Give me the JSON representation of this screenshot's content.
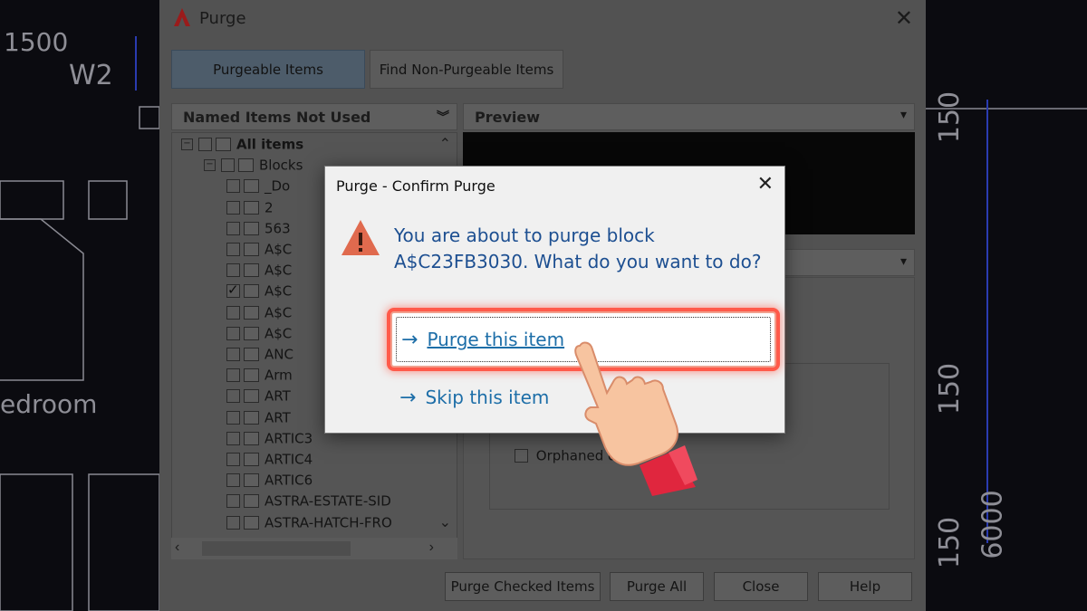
{
  "background_cad": {
    "labels": [
      "1500",
      "W2",
      "edroom"
    ],
    "vertical_labels": [
      "150",
      "150",
      "150",
      "6000"
    ]
  },
  "purge_dialog": {
    "title": "Purge",
    "tabs": [
      "Purgeable Items",
      "Find Non-Purgeable Items"
    ],
    "tree_header": "Named Items Not Used",
    "preview_header": "Preview",
    "tree_items": [
      {
        "label": "All items",
        "level": 0,
        "checked": false
      },
      {
        "label": "Blocks",
        "level": 1,
        "checked": false
      },
      {
        "label": "_Do",
        "level": 2,
        "checked": false
      },
      {
        "label": "2",
        "level": 2,
        "checked": false
      },
      {
        "label": "563",
        "level": 2,
        "checked": false
      },
      {
        "label": "A$C",
        "level": 2,
        "checked": false
      },
      {
        "label": "A$C",
        "level": 2,
        "checked": false
      },
      {
        "label": "A$C",
        "level": 2,
        "checked": true
      },
      {
        "label": "A$C",
        "level": 2,
        "checked": false
      },
      {
        "label": "A$C",
        "level": 2,
        "checked": false
      },
      {
        "label": "ANC",
        "level": 2,
        "checked": false
      },
      {
        "label": "Arm",
        "level": 2,
        "checked": false
      },
      {
        "label": "ART",
        "level": 2,
        "checked": false
      },
      {
        "label": "ART",
        "level": 2,
        "checked": false
      },
      {
        "label": "ARTIC3",
        "level": 2,
        "checked": false
      },
      {
        "label": "ARTIC4",
        "level": 2,
        "checked": false
      },
      {
        "label": "ARTIC6",
        "level": 2,
        "checked": false
      },
      {
        "label": "ASTRA-ESTATE-SID",
        "level": 2,
        "checked": false
      },
      {
        "label": "ASTRA-HATCH-FRO",
        "level": 2,
        "checked": false
      }
    ],
    "orphaned_label": "Orphaned data",
    "orphaned_checked": false,
    "buttons": {
      "purge_checked": "Purge Checked Items",
      "purge_all": "Purge All",
      "close": "Close",
      "help": "Help"
    }
  },
  "confirm_dialog": {
    "title": "Purge - Confirm Purge",
    "message": "You are about to purge block A$C23FB3030. What do you want to do?",
    "option_purge": "Purge this item",
    "option_skip": "Skip this item",
    "highlight_color": "#ff5a4a",
    "link_color": "#1d6ea8"
  }
}
